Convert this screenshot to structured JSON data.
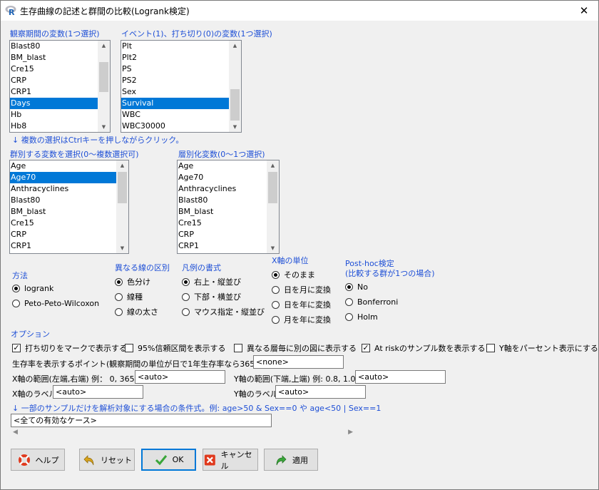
{
  "window": {
    "title": "生存曲線の記述と群間の比較(Logrank検定)",
    "close": "✕"
  },
  "time_var": {
    "label": "観察期間の変数(1つ選択)",
    "items": [
      "Blast80",
      "BM_blast",
      "Cre15",
      "CRP",
      "CRP1",
      "Days",
      "Hb",
      "Hb8"
    ],
    "selected": "Days"
  },
  "event_var": {
    "label": "イベント(1)、打ち切り(0)の変数(1つ選択)",
    "items": [
      "Plt",
      "Plt2",
      "PS",
      "PS2",
      "Sex",
      "Survival",
      "WBC",
      "WBC30000"
    ],
    "selected": "Survival"
  },
  "multi_hint": "↓ 複数の選択はCtrlキーを押しながらクリック。",
  "group_var": {
    "label": "群別する変数を選択(0～複数選択可)",
    "items": [
      "Age",
      "Age70",
      "Anthracyclines",
      "Blast80",
      "BM_blast",
      "Cre15",
      "CRP",
      "CRP1"
    ],
    "selected": "Age70"
  },
  "strata_var": {
    "label": "層別化変数(0～1つ選択)",
    "items": [
      "Age",
      "Age70",
      "Anthracyclines",
      "Blast80",
      "BM_blast",
      "Cre15",
      "CRP",
      "CRP1"
    ],
    "selected": ""
  },
  "method": {
    "label": "方法",
    "options": [
      "logrank",
      "Peto-Peto-Wilcoxon"
    ],
    "selected": 0
  },
  "line_style": {
    "label": "異なる線の区別",
    "options": [
      "色分け",
      "線種",
      "線の太さ"
    ],
    "selected": 0
  },
  "legend": {
    "label": "凡例の書式",
    "options": [
      "右上・縦並び",
      "下部・横並び",
      "マウス指定・縦並び"
    ],
    "selected": 0
  },
  "xunit": {
    "label": "X軸の単位",
    "options": [
      "そのまま",
      "日を月に変換",
      "日を年に変換",
      "月を年に変換"
    ],
    "selected": 0
  },
  "posthoc": {
    "label1": "Post-hoc検定",
    "label2": "(比較する群が1つの場合)",
    "options": [
      "No",
      "Bonferroni",
      "Holm"
    ],
    "selected": 0
  },
  "options": {
    "label": "オプション",
    "checks": [
      {
        "label": "打ち切りをマークで表示する",
        "checked": true
      },
      {
        "label": "95%信頼区間を表示する",
        "checked": false
      },
      {
        "label": "異なる層毎に別の図に表示する",
        "checked": false
      },
      {
        "label": "At riskのサンプル数を表示する",
        "checked": true
      },
      {
        "label": "Y軸をパーセント表示にする",
        "checked": false
      }
    ],
    "survival_point_label": "生存率を表示するポイント(観察期間の単位が日で1年生存率なら365)",
    "survival_point_value": "<none>",
    "xrange_label": "X軸の範囲(左端,右端) 例： 0, 365",
    "xrange_value": "<auto>",
    "yrange_label": "Y軸の範囲(下端,上端) 例: 0.8, 1.0",
    "yrange_value": "<auto>",
    "xlabel_label": "X軸のラベル",
    "xlabel_value": "<auto>",
    "ylabel_label": "Y軸のラベル",
    "ylabel_value": "<auto>",
    "subset_label": "↓ 一部のサンプルだけを解析対象にする場合の条件式。例: age>50 & Sex==0 や age<50 | Sex==1",
    "subset_value": "<全ての有効なケース>"
  },
  "buttons": {
    "help": "ヘルプ",
    "reset": "リセット",
    "ok": "OK",
    "cancel": "キャンセル",
    "apply": "適用"
  },
  "colors": {
    "selection": "#0078d7",
    "label_blue": "#1e4fd6",
    "background": "#f0f0f0"
  }
}
